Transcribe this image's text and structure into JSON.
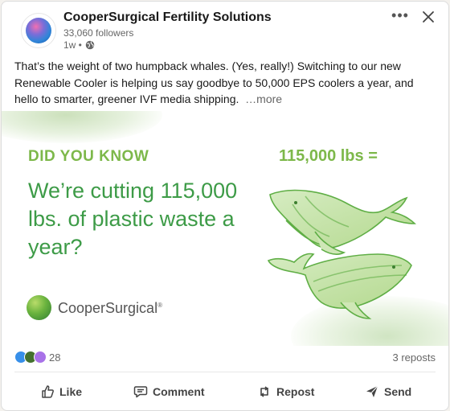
{
  "post": {
    "company": "CooperSurgical Fertility Solutions",
    "followers": "33,060 followers",
    "time": "1w •",
    "text": "That’s the weight of two humpback whales. (Yes, really!) Switching to our new Renewable Cooler is helping us say goodbye to 50,000 EPS coolers a year, and hello to smarter, greener IVF media shipping.",
    "see_more": "…more"
  },
  "image": {
    "did_you_know": "DID YOU KNOW",
    "headline": "We’re cutting 115,000 lbs. of plastic waste a year?",
    "stat": "115,000 lbs =",
    "brand": "CooperSurgical",
    "brand_mark": "®"
  },
  "stats": {
    "reactions_count": "28",
    "reposts": "3 reposts"
  },
  "actions": {
    "like": "Like",
    "comment": "Comment",
    "repost": "Repost",
    "send": "Send"
  },
  "colors": {
    "accent_green": "#3d9b47",
    "light_green": "#7db84a"
  },
  "icons": [
    "globe-icon",
    "more-options-icon",
    "close-icon",
    "like-icon",
    "comment-icon",
    "repost-icon",
    "send-icon"
  ]
}
